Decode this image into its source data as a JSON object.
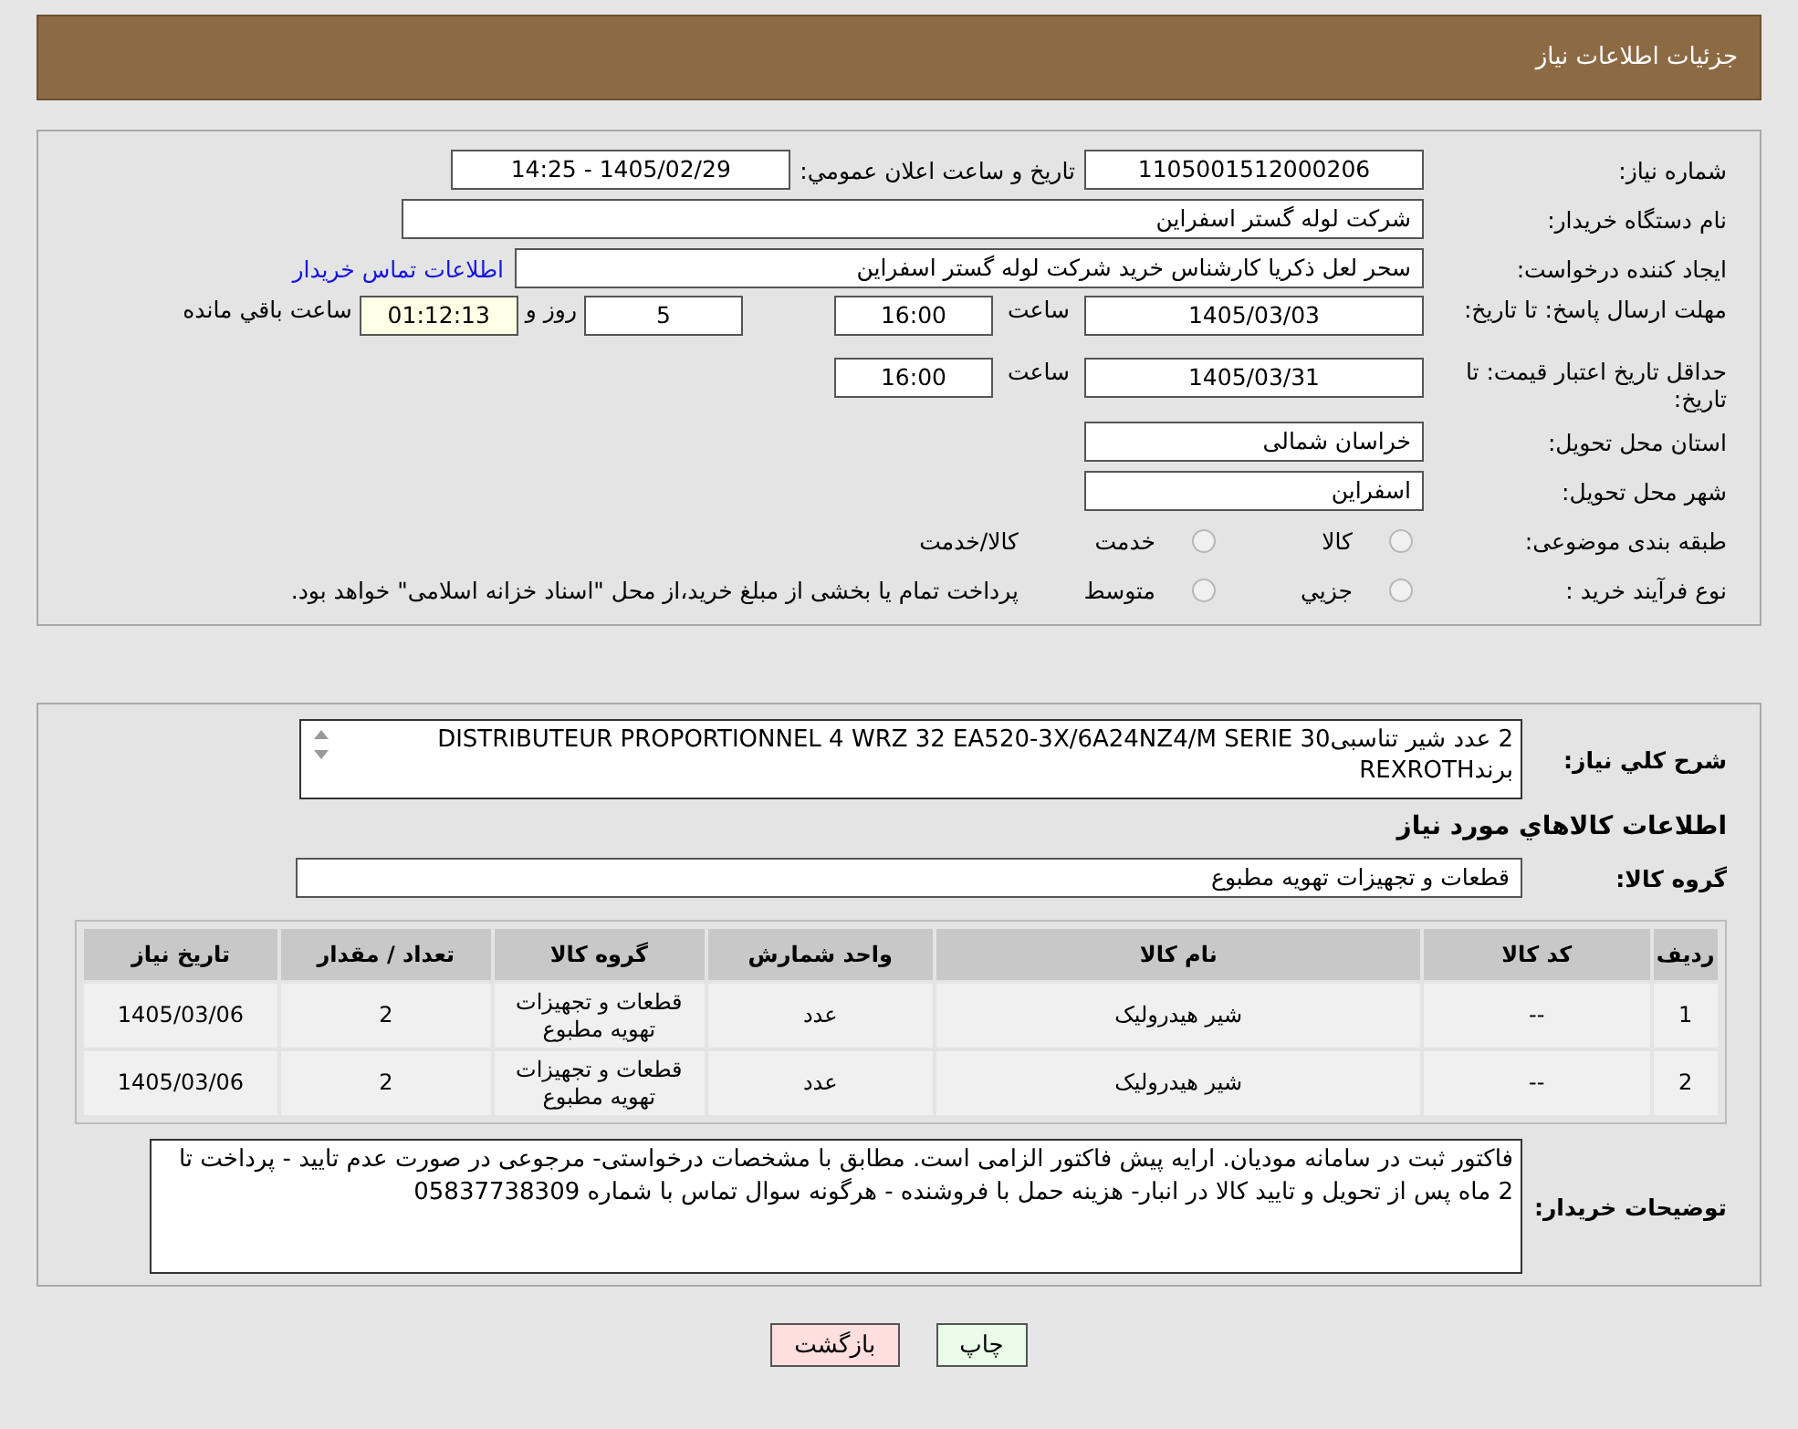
{
  "header": {
    "title": "جزئیات اطلاعات نیاز"
  },
  "form": {
    "need_number": {
      "label": "شماره نیاز:",
      "value": "1105001512000206"
    },
    "announce": {
      "label": "تاریخ و ساعت اعلان عمومي:",
      "value": "1405/02/29 - 14:25"
    },
    "buyer_org": {
      "label": "نام دستگاه خریدار:",
      "value": "شرکت لوله گستر اسفراین"
    },
    "requester": {
      "label": "ایجاد کننده درخواست:",
      "value": "سحر لعل ذکریا کارشناس خرید شرکت لوله گستر اسفراین",
      "link": "اطلاعات تماس خریدار"
    },
    "reply_deadline": {
      "label": "مهلت ارسال پاسخ: تا تاریخ:",
      "date": "1405/03/03",
      "time_label": "ساعت",
      "time": "16:00",
      "days": "5",
      "days_label": "روز و",
      "remaining": "01:12:13",
      "remaining_label": "ساعت باقي مانده"
    },
    "price_validity": {
      "label": "حداقل تاریخ اعتبار قیمت: تا تاریخ:",
      "date": "1405/03/31",
      "time_label": "ساعت",
      "time": "16:00"
    },
    "province": {
      "label": "استان محل تحویل:",
      "value": "خراسان شمالی"
    },
    "city": {
      "label": "شهر محل تحویل:",
      "value": "اسفراین"
    },
    "category": {
      "label": "طبقه بندی موضوعی:",
      "options": [
        {
          "label": "کالا",
          "kind": "radio",
          "selected": false
        },
        {
          "label": "خدمت",
          "kind": "radio",
          "selected": false
        },
        {
          "label": "کالا/خدمت",
          "kind": "text"
        }
      ]
    },
    "purchase_type": {
      "label": "نوع فرآیند خرید :",
      "options": [
        {
          "label": "جزیي",
          "kind": "radio",
          "selected": false
        },
        {
          "label": "متوسط",
          "kind": "radio",
          "selected": false
        },
        {
          "label": "پرداخت تمام یا بخشی از مبلغ خرید،از محل \"اسناد خزانه اسلامی\" خواهد بود.",
          "kind": "text"
        }
      ]
    }
  },
  "details": {
    "description": {
      "label": "شرح کلي نیاز:",
      "value": "2 عدد شیر تناسبیDISTRIBUTEUR PROPORTIONNEL 4 WRZ 32 EA520-3X/6A24NZ4/M SERIE 30 برندREXROTH"
    },
    "goods_heading": "اطلاعات کالاهاي مورد نیاز",
    "goods_group": {
      "label": "گروه کالا:",
      "value": "قطعات و تجهیزات تهویه مطبوع"
    },
    "table": {
      "columns": [
        "ردیف",
        "کد کالا",
        "نام کالا",
        "واحد شمارش",
        "گروه کالا",
        "تعداد / مقدار",
        "تاریخ نیاز"
      ],
      "rows": [
        [
          "1",
          "--",
          "شیر هیدرولیک",
          "عدد",
          "قطعات و تجهیزات تهویه مطبوع",
          "2",
          "1405/03/06"
        ],
        [
          "2",
          "--",
          "شیر هیدرولیک",
          "عدد",
          "قطعات و تجهیزات تهویه مطبوع",
          "2",
          "1405/03/06"
        ]
      ]
    },
    "buyer_notes": {
      "label": "توضیحات خریدار:",
      "value": "فاکتور ثبت در سامانه مودیان. ارایه پیش فاکتور الزامی است. مطابق با مشخصات درخواستی- مرجوعی در صورت عدم تایید - پرداخت تا 2 ماه پس از تحویل و تایید کالا در انبار- هزینه حمل با فروشنده - هرگونه سوال تماس با شماره 05837738309"
    }
  },
  "buttons": [
    {
      "label": "چاپ",
      "color": "#e9fde9"
    },
    {
      "label": "بازگشت",
      "color": "#ffdede"
    }
  ]
}
